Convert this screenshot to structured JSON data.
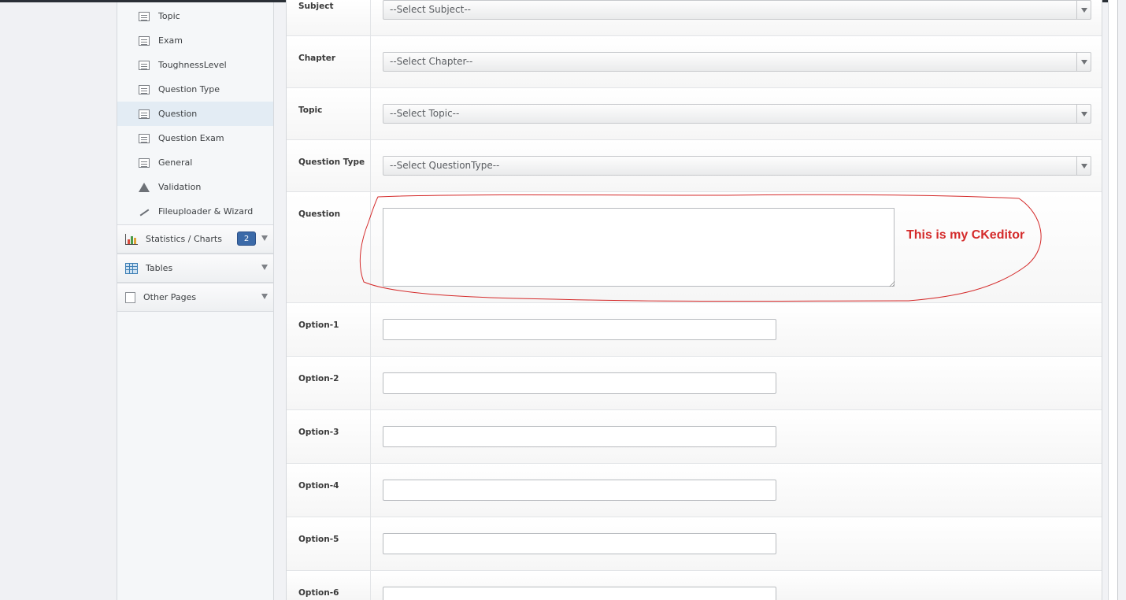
{
  "sidebar": {
    "sub_items": [
      {
        "label": "Topic",
        "icon": "list-icon"
      },
      {
        "label": "Exam",
        "icon": "list-icon"
      },
      {
        "label": "ToughnessLevel",
        "icon": "list-icon"
      },
      {
        "label": "Question Type",
        "icon": "list-icon"
      },
      {
        "label": "Question",
        "icon": "list-icon",
        "active": true
      },
      {
        "label": "Question Exam",
        "icon": "list-icon"
      },
      {
        "label": "General",
        "icon": "list-icon"
      },
      {
        "label": "Validation",
        "icon": "warning-icon"
      },
      {
        "label": "Fileuploader & Wizard",
        "icon": "wand-icon"
      }
    ],
    "groups": [
      {
        "label": "Statistics / Charts",
        "icon": "bar-chart-icon",
        "badge": "2"
      },
      {
        "label": "Tables",
        "icon": "table-icon"
      },
      {
        "label": "Other Pages",
        "icon": "page-icon"
      }
    ]
  },
  "form": {
    "subject": {
      "label": "Subject",
      "value": "--Select Subject--"
    },
    "chapter": {
      "label": "Chapter",
      "value": "--Select Chapter--"
    },
    "topic": {
      "label": "Topic",
      "value": "--Select Topic--"
    },
    "question_type": {
      "label": "Question Type",
      "value": "--Select QuestionType--"
    },
    "question": {
      "label": "Question",
      "value": ""
    },
    "options": [
      {
        "label": "Option-1",
        "value": ""
      },
      {
        "label": "Option-2",
        "value": ""
      },
      {
        "label": "Option-3",
        "value": ""
      },
      {
        "label": "Option-4",
        "value": ""
      },
      {
        "label": "Option-5",
        "value": ""
      },
      {
        "label": "Option-6",
        "value": ""
      }
    ]
  },
  "annotation": {
    "text": "This is my CKeditor",
    "color": "#d42a2a"
  }
}
